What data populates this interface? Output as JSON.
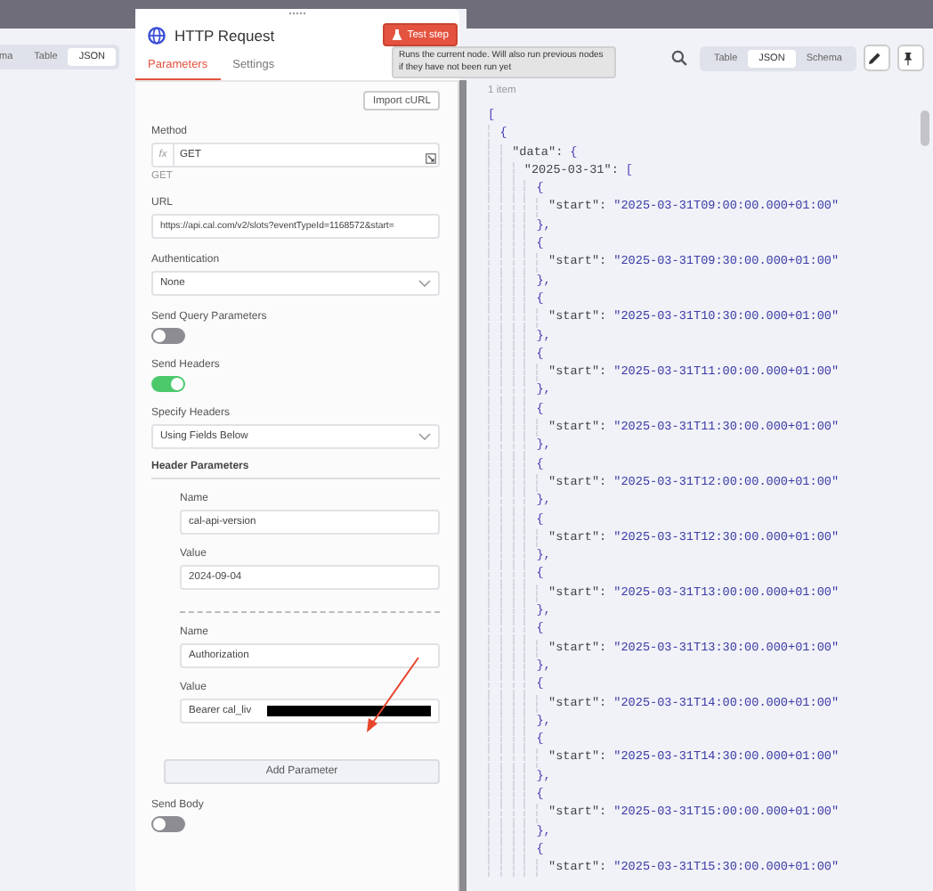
{
  "input_pane": {
    "view_tabs": [
      {
        "label": "ma",
        "selected": false
      },
      {
        "label": "Table",
        "selected": false
      },
      {
        "label": "JSON",
        "selected": true
      }
    ]
  },
  "node": {
    "title": "HTTP Request",
    "test_button": "Test step",
    "tooltip": "Runs the current node. Will also run previous nodes if they have not been run yet",
    "tabs": [
      {
        "label": "Parameters",
        "selected": true
      },
      {
        "label": "Settings",
        "selected": false
      }
    ],
    "import_button": "Import cURL",
    "fields": [
      {
        "kind": "expression",
        "label": "Method",
        "prefix": "fx",
        "value": "GET",
        "hint": "GET"
      },
      {
        "kind": "text",
        "label": "URL",
        "value": "https://api.cal.com/v2/slots?eventTypeId=1168572&start="
      },
      {
        "kind": "select",
        "label": "Authentication",
        "value": "None"
      },
      {
        "kind": "toggle",
        "label": "Send Query Parameters",
        "on": false
      },
      {
        "kind": "toggle",
        "label": "Send Headers",
        "on": true
      },
      {
        "kind": "select",
        "label": "Specify Headers",
        "value": "Using Fields Below"
      }
    ],
    "header_parameters": {
      "title": "Header Parameters",
      "items": [
        {
          "name_label": "Name",
          "name": "cal-api-version",
          "value_label": "Value",
          "value": "2024-09-04",
          "redacted": false
        },
        {
          "name_label": "Name",
          "name": "Authorization",
          "value_label": "Value",
          "value": "Bearer cal_liv",
          "redacted": true
        }
      ],
      "add_button": "Add Parameter"
    },
    "send_body": {
      "label": "Send Body",
      "on": false
    }
  },
  "output_pane": {
    "view_tabs": [
      {
        "label": "Table",
        "selected": false
      },
      {
        "label": "JSON",
        "selected": true
      },
      {
        "label": "Schema",
        "selected": false
      }
    ],
    "item_count": "1 item",
    "json": {
      "open": "[",
      "children": [
        {
          "open": "{",
          "children": [
            {
              "key": "\"data\":",
              "open": "{",
              "children": [
                {
                  "key": "\"2025-03-31\":",
                  "open": "[",
                  "children": [
                    {
                      "open": "{",
                      "children": [
                        {
                          "key": "\"start\":",
                          "value": "\"2025-03-31T09:00:00.000+01:00\""
                        }
                      ],
                      "close": "},"
                    },
                    {
                      "open": "{",
                      "children": [
                        {
                          "key": "\"start\":",
                          "value": "\"2025-03-31T09:30:00.000+01:00\""
                        }
                      ],
                      "close": "},"
                    },
                    {
                      "open": "{",
                      "children": [
                        {
                          "key": "\"start\":",
                          "value": "\"2025-03-31T10:30:00.000+01:00\""
                        }
                      ],
                      "close": "},"
                    },
                    {
                      "open": "{",
                      "children": [
                        {
                          "key": "\"start\":",
                          "value": "\"2025-03-31T11:00:00.000+01:00\""
                        }
                      ],
                      "close": "},"
                    },
                    {
                      "open": "{",
                      "children": [
                        {
                          "key": "\"start\":",
                          "value": "\"2025-03-31T11:30:00.000+01:00\""
                        }
                      ],
                      "close": "},"
                    },
                    {
                      "open": "{",
                      "children": [
                        {
                          "key": "\"start\":",
                          "value": "\"2025-03-31T12:00:00.000+01:00\""
                        }
                      ],
                      "close": "},"
                    },
                    {
                      "open": "{",
                      "children": [
                        {
                          "key": "\"start\":",
                          "value": "\"2025-03-31T12:30:00.000+01:00\""
                        }
                      ],
                      "close": "},"
                    },
                    {
                      "open": "{",
                      "children": [
                        {
                          "key": "\"start\":",
                          "value": "\"2025-03-31T13:00:00.000+01:00\""
                        }
                      ],
                      "close": "},"
                    },
                    {
                      "open": "{",
                      "children": [
                        {
                          "key": "\"start\":",
                          "value": "\"2025-03-31T13:30:00.000+01:00\""
                        }
                      ],
                      "close": "},"
                    },
                    {
                      "open": "{",
                      "children": [
                        {
                          "key": "\"start\":",
                          "value": "\"2025-03-31T14:00:00.000+01:00\""
                        }
                      ],
                      "close": "},"
                    },
                    {
                      "open": "{",
                      "children": [
                        {
                          "key": "\"start\":",
                          "value": "\"2025-03-31T14:30:00.000+01:00\""
                        }
                      ],
                      "close": "},"
                    },
                    {
                      "open": "{",
                      "children": [
                        {
                          "key": "\"start\":",
                          "value": "\"2025-03-31T15:00:00.000+01:00\""
                        }
                      ],
                      "close": "},"
                    },
                    {
                      "open": "{",
                      "children": [
                        {
                          "key": "\"start\":",
                          "value": "\"2025-03-31T15:30:00.000+01:00\""
                        }
                      ]
                    }
                  ]
                }
              ]
            }
          ]
        }
      ]
    }
  }
}
